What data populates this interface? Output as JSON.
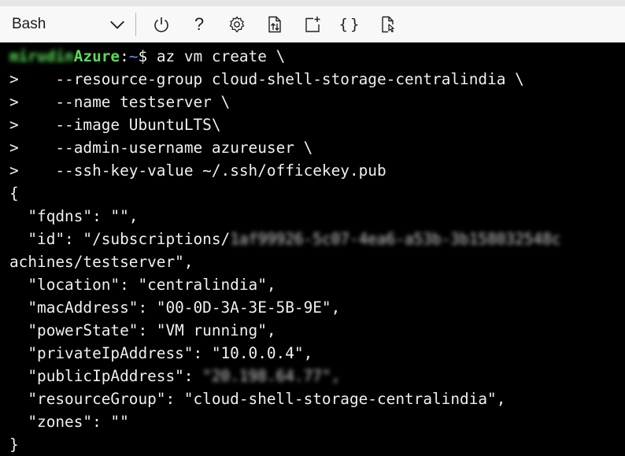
{
  "toolbar": {
    "shell": "Bash",
    "icons": [
      "chevron-down-icon",
      "power-icon",
      "help-icon",
      "settings-icon",
      "upload-download-icon",
      "new-session-icon",
      "editor-braces-icon",
      "web-preview-icon"
    ],
    "help_glyph": "?",
    "braces_glyph": "{}"
  },
  "terminal": {
    "prompt_user": "mirudin",
    "prompt_host": "Azure",
    "prompt_sep": ":",
    "prompt_path": "~",
    "prompt_dollar": "$ ",
    "command": "az vm create \\",
    "cont_prefix": ">",
    "continuations": [
      "    --resource-group cloud-shell-storage-centralindia \\",
      "    --name testserver \\",
      "    --image UbuntuLTS\\",
      "    --admin-username azureuser \\",
      "    --ssh-key-value ~/.ssh/officekey.pub"
    ],
    "open_brace": "{",
    "fqdns": "  \"fqdns\": \"\",",
    "id_prefix": "  \"id\": \"/subscriptions/",
    "id_redacted": "1af99926-5c07-4ea6-a53b-3b158032548c",
    "id_cont": "achines/testserver\",",
    "location": "  \"location\": \"centralindia\",",
    "mac": "  \"macAddress\": \"00-0D-3A-3E-5B-9E\",",
    "power": "  \"powerState\": \"VM running\",",
    "private_ip": "  \"privateIpAddress\": \"10.0.0.4\",",
    "public_ip_prefix": "  \"publicIpAddress\": ",
    "public_ip_redacted": "\"20.198.64.77\",",
    "resource_group": "  \"resourceGroup\": \"cloud-shell-storage-centralindia\",",
    "zones": "  \"zones\": \"\"",
    "close_brace": "}"
  }
}
